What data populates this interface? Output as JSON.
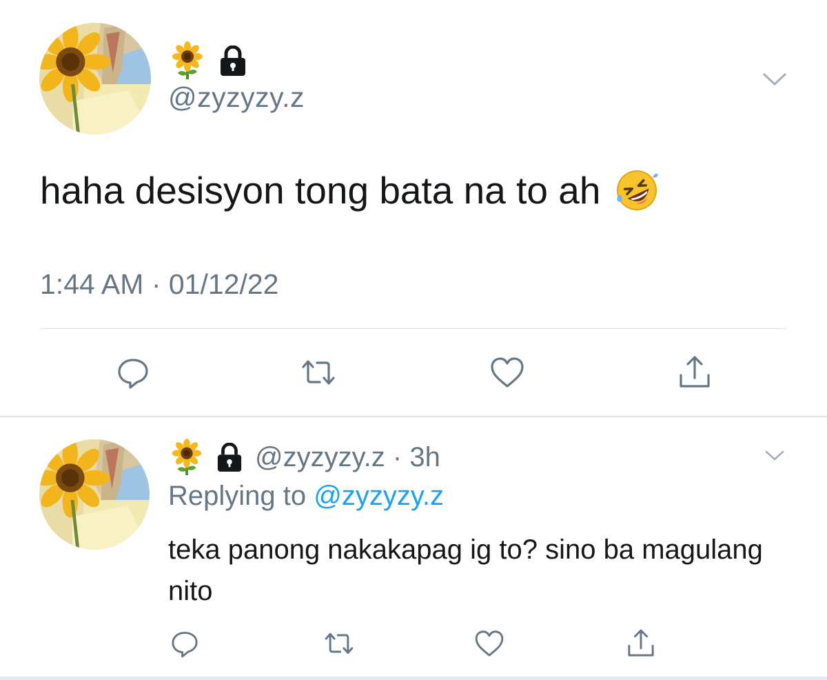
{
  "main_tweet": {
    "display_name_emoji": "sunflower-icon",
    "protected_icon": "lock-icon",
    "handle": "@zyzyzy.z",
    "text": "haha desisyon tong bata na to ah",
    "text_emoji": "rolling-on-floor-laughing-icon",
    "timestamp": "1:44 AM · 01/12/22",
    "actions": [
      "reply-icon",
      "retweet-icon",
      "like-icon",
      "share-icon"
    ]
  },
  "reply_tweet": {
    "display_name_emoji": "sunflower-icon",
    "protected_icon": "lock-icon",
    "handle": "@zyzyzy.z",
    "separator": "·",
    "time_ago": "3h",
    "replying_to_label": "Replying to",
    "replying_to_handle": "@zyzyzy.z",
    "text": "teka panong nakakapag ig to? sino ba magulang nito",
    "actions": [
      "reply-icon",
      "retweet-icon",
      "like-icon",
      "share-icon"
    ]
  },
  "colors": {
    "primary_text": "#14171a",
    "secondary_text": "#657786",
    "link": "#1da1f2",
    "divider": "#e1e8ed"
  }
}
